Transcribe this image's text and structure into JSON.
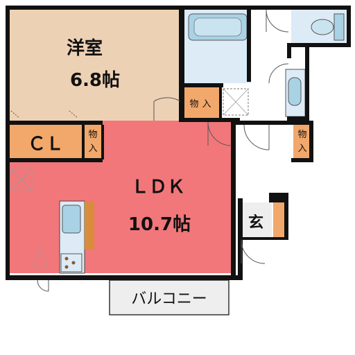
{
  "rooms": {
    "western": {
      "name": "洋室",
      "size": "6.8帖"
    },
    "ldk": {
      "name": "ＬＤＫ",
      "size": "10.7帖"
    },
    "closet": {
      "name": "ＣＬ"
    },
    "storage_1": {
      "name_top": "物",
      "name_bottom": "入"
    },
    "storage_2": {
      "name_top": "物",
      "name_bottom": "入"
    },
    "storage_3": {
      "name_top": "物",
      "name_bottom": "入"
    },
    "entrance": {
      "name": "玄"
    },
    "balcony": {
      "name": "バルコニー"
    }
  },
  "colors": {
    "western_room": "#EDD1B5",
    "ldk": "#F2777A",
    "closet": "#F2A86A",
    "storage": "#F2A86A",
    "wet_area": "#DDEBF7",
    "fixture_blue": "#A9D3E5",
    "balcony": "#EEEEEE",
    "wall": "#111111",
    "counter": "#D98C3C"
  }
}
